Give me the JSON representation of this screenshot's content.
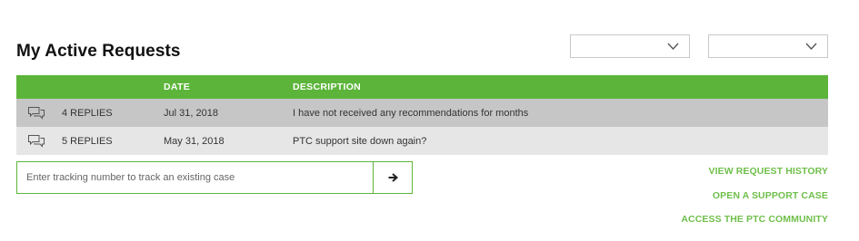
{
  "page": {
    "title": "My Active Requests"
  },
  "filters": [
    {
      "selected": ""
    },
    {
      "selected": ""
    }
  ],
  "table": {
    "header_color": "#5cb53a",
    "columns": [
      "",
      "",
      "DATE",
      "DESCRIPTION"
    ],
    "rows": [
      {
        "icon": "chat-bubbles-icon",
        "replies": "4 REPLIES",
        "date": "Jul 31, 2018",
        "description": "I have not received any recommendations for months"
      },
      {
        "icon": "chat-bubbles-icon",
        "replies": "5 REPLIES",
        "date": "May 31, 2018",
        "description": "PTC support site down again?"
      }
    ]
  },
  "tracking": {
    "placeholder": "Enter tracking number to track an existing case",
    "value": "",
    "submit_icon": "arrow-right-icon"
  },
  "links": {
    "view_history": "VIEW REQUEST HISTORY",
    "open_case": "OPEN A SUPPORT CASE",
    "community": "ACCESS THE PTC COMMUNITY"
  },
  "colors": {
    "accent": "#5cb53a",
    "link": "#6fbf4a",
    "row_selected": "#c6c6c6",
    "row_alt": "#e6e6e6"
  }
}
